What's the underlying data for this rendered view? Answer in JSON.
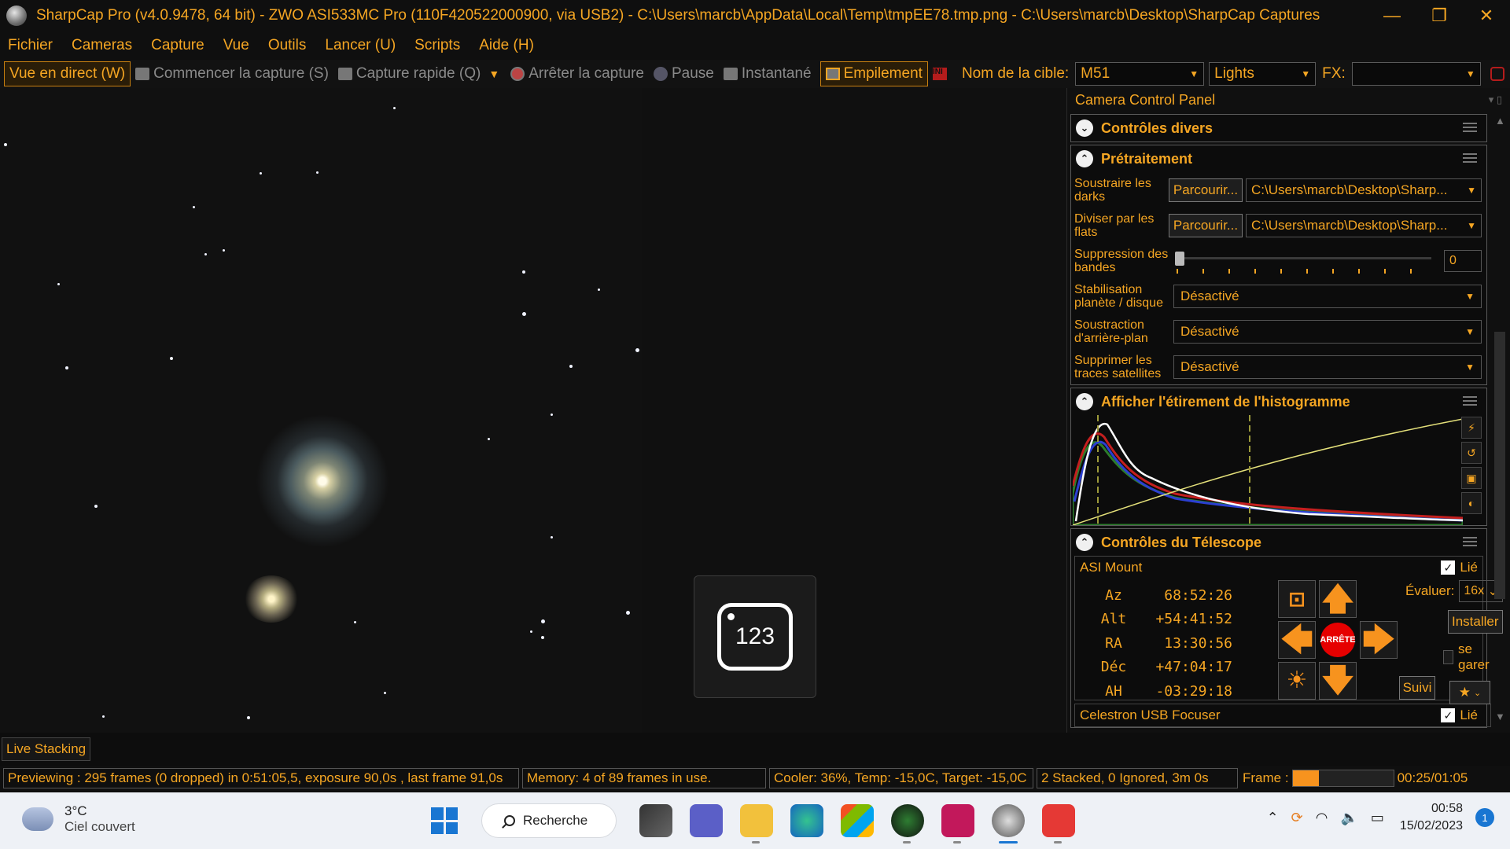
{
  "titlebar": {
    "title": "SharpCap Pro (v4.0.9478, 64 bit) - ZWO ASI533MC Pro (110F420522000900, via USB2) - C:\\Users\\marcb\\AppData\\Local\\Temp\\tmpEE78.tmp.png - C:\\Users\\marcb\\Desktop\\SharpCap Captures",
    "minimize": "—",
    "restore": "❐",
    "close": "✕"
  },
  "menu": [
    "Fichier",
    "Cameras",
    "Capture",
    "Vue",
    "Outils",
    "Lancer (U)",
    "Scripts",
    "Aide (H)"
  ],
  "toolbar": {
    "live_view": "Vue en direct (W)",
    "start_capture": "Commencer la capture (S)",
    "quick_capture": "Capture rapide (Q)",
    "stop_capture": "Arrêter la capture",
    "pause": "Pause",
    "snapshot": "Instantané",
    "stacking": "Empilement",
    "ini_icon": "INI",
    "target_label": "Nom de la cible:",
    "target_value": "M51",
    "frame_type": "Lights",
    "fx_label": "FX:",
    "fx_value": ""
  },
  "badge": {
    "text": "123"
  },
  "panel": {
    "title": "Camera Control Panel",
    "tools": "▾ ▯",
    "misc_section": "Contrôles divers",
    "preprocessing": {
      "title": "Prétraitement",
      "darks_label": "Soustraire les darks",
      "flats_label": "Diviser par les flats",
      "browse_label": "Parcourir...",
      "darks_path": "C:\\Users\\marcb\\Desktop\\Sharp...",
      "flats_path": "C:\\Users\\marcb\\Desktop\\Sharp...",
      "banding_label": "Suppression des bandes",
      "banding_value": "0",
      "stab_label": "Stabilisation planète / disque",
      "stab_value": "Désactivé",
      "bg_label": "Soustraction d'arrière-plan",
      "bg_value": "Désactivé",
      "sat_label": "Supprimer les traces satellites",
      "sat_value": "Désactivé"
    },
    "histogram": {
      "title": "Afficher l'étirement de l'histogramme"
    },
    "telescope": {
      "title": "Contrôles du Télescope",
      "mount_name": "ASI Mount",
      "linked_label": "Lié",
      "coords": [
        {
          "k": "Az",
          "v": "68:52:26"
        },
        {
          "k": "Alt",
          "v": "+54:41:52"
        },
        {
          "k": "RA",
          "v": "13:30:56"
        },
        {
          "k": "Déc",
          "v": "+47:04:17"
        },
        {
          "k": "AH",
          "v": "-03:29:18"
        }
      ],
      "stop_label": "ARRÊTE",
      "rate_label": "Évaluer:",
      "rate_value": "16x",
      "install_label": "Installer",
      "park_label": "se garer",
      "track_label": "Suivi"
    },
    "focuser": {
      "name": "Celestron USB Focuser",
      "linked_label": "Lié"
    }
  },
  "live_stacking_tab": "Live Stacking",
  "status": {
    "preview": "Previewing : 295 frames (0 dropped) in 0:51:05,5, exposure 90,0s , last frame 91,0s",
    "memory": "Memory: 4 of 89 frames in use.",
    "cooler": "Cooler: 36%, Temp: -15,0C, Target: -15,0C",
    "stacked": "2 Stacked, 0 Ignored, 3m 0s",
    "frame_label": "Frame :",
    "frame_progress": 0.26,
    "frame_time": "00:25/01:05"
  },
  "taskbar": {
    "temp": "3°C",
    "weather": "Ciel couvert",
    "search": "Recherche",
    "time": "00:58",
    "date": "15/02/2023",
    "notif_count": "1"
  },
  "colors": {
    "accent": "#f5a623",
    "stop": "#e60000",
    "arrow": "#f7931e"
  }
}
